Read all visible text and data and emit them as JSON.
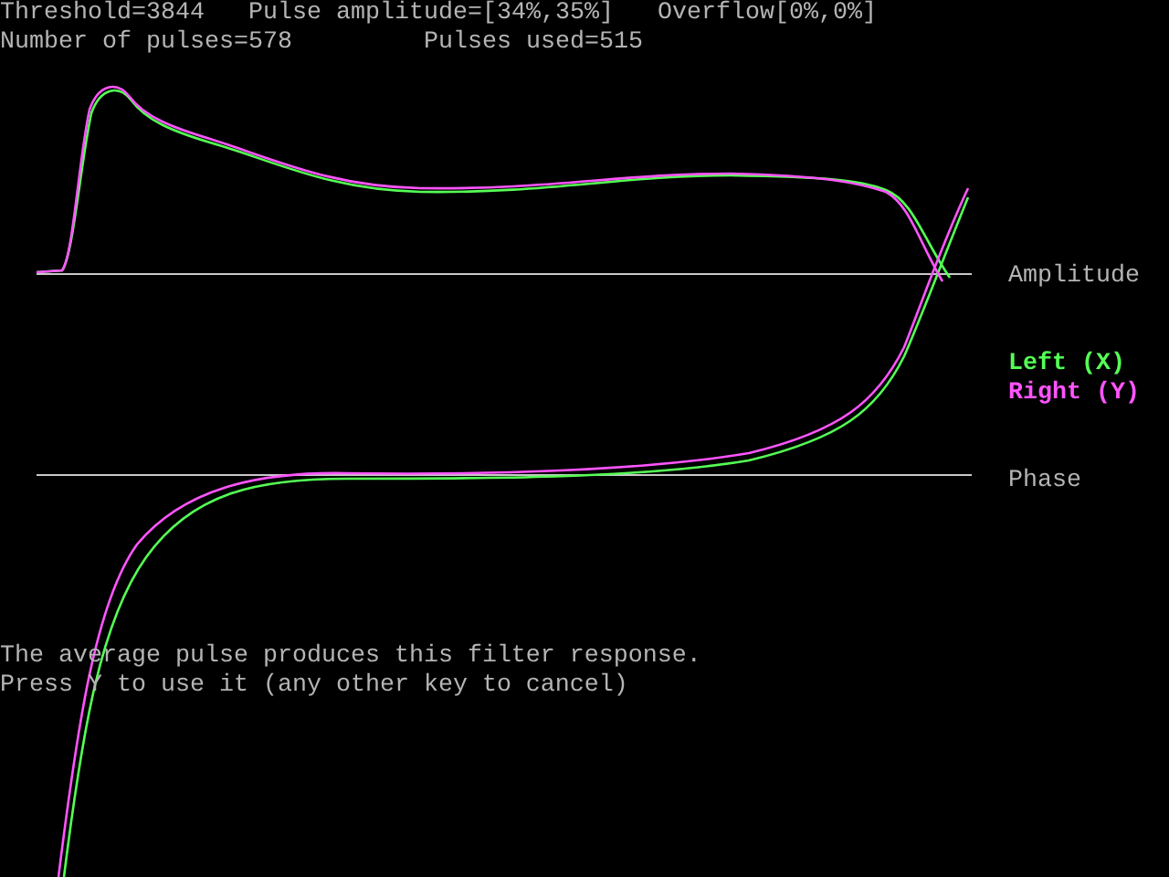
{
  "status": {
    "threshold": "Threshold=3844",
    "pulse_amplitude": "Pulse amplitude=[34%,35%]",
    "overflow": "Overflow[0%,0%]",
    "pulses": "Number of pulses=578",
    "pulses_used": "Pulses used=515"
  },
  "plot": {
    "axis_labels": [
      "Amplitude",
      "Phase"
    ],
    "legend": [
      {
        "label": "Left (X)",
        "color": "#55ff55"
      },
      {
        "label": "Right (Y)",
        "color": "#ff55ff"
      }
    ]
  },
  "message": [
    "The average pulse produces this filter response.",
    "Press Y to use it (any other key to cancel)"
  ]
}
